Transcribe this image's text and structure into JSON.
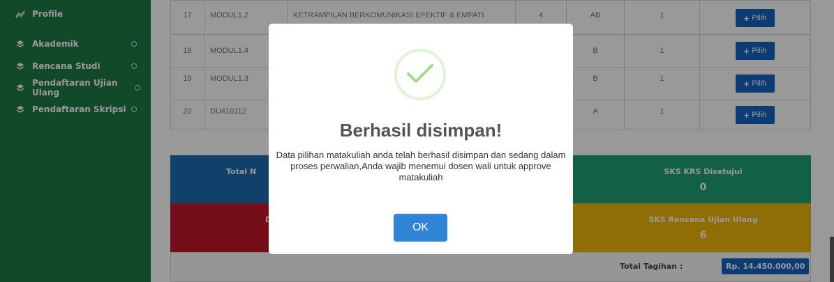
{
  "sidebar": {
    "items": [
      {
        "label": "Profile",
        "icon": "line-chart-icon",
        "has_ring": false
      },
      {
        "label": "Akademik",
        "icon": "layers-icon",
        "has_ring": true
      },
      {
        "label": "Rencana Studi",
        "icon": "layers-icon",
        "has_ring": true
      },
      {
        "label": "Pendaftaran Ujian Ulang",
        "icon": "layers-icon",
        "has_ring": true
      },
      {
        "label": "Pendaftaran Skripsi",
        "icon": "layers-icon",
        "has_ring": true
      }
    ]
  },
  "table": {
    "rows": [
      {
        "no": "17",
        "code": "MODUL1.2",
        "name": "KETRAMPILAN BERKOMUNIKASI EFEKTIF & EMPATI",
        "sks": "4",
        "grade": "AB",
        "x": "1",
        "action": "Pilih"
      },
      {
        "no": "18",
        "code": "MODUL1.4",
        "name": "",
        "sks": "",
        "grade": "B",
        "x": "1",
        "action": "Pilih"
      },
      {
        "no": "19",
        "code": "MODUL1.3",
        "name": "",
        "sks": "",
        "grade": "B",
        "x": "1",
        "action": "Pilih"
      },
      {
        "no": "20",
        "code": "DU410112",
        "name": "",
        "sks": "",
        "grade": "A",
        "x": "1",
        "action": "Pilih"
      }
    ]
  },
  "summary": {
    "total_label": "Total N",
    "disetujui_label": "SKS KRS Disetujui",
    "disetujui_value": "0",
    "d_label": "D",
    "ujian_ulang_label": "SKS Rencana Ujian Ulang",
    "ujian_ulang_value": "6",
    "tagihan_label": "Total Tagihan :",
    "tagihan_value": "Rp. 14.450.000,00"
  },
  "modal": {
    "title": "Berhasil disimpan!",
    "message": "Data pilihan matakuliah anda telah berhasil disimpan dan sedang dalam proses perwalian,Anda wajib menemui dosen wali untuk approve matakuliah",
    "ok_label": "OK"
  },
  "colors": {
    "sidebar": "#1f7a45",
    "primary": "#1565c0",
    "box_blue": "#1a6db3",
    "box_green": "#21a07a",
    "box_red": "#c5182a",
    "box_yellow": "#f1b70a",
    "ok_button": "#3085d6",
    "check": "#a5dc86"
  }
}
